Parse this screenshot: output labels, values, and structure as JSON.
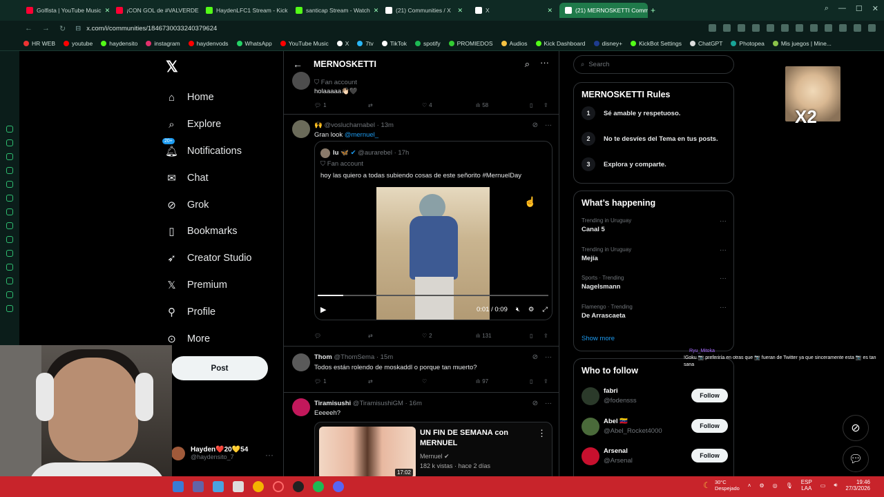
{
  "browser": {
    "tabs": [
      {
        "label": "Golfista | YouTube Music",
        "color": "#ff0033"
      },
      {
        "label": "¡CON GOL de #VALVERDE",
        "color": "#ff0033"
      },
      {
        "label": "HaydenLFC1 Stream - Kick",
        "color": "#53fc18"
      },
      {
        "label": "santicap Stream - Watch",
        "color": "#53fc18"
      },
      {
        "label": "(21) Communities / X",
        "color": "#ffffff"
      },
      {
        "label": "X",
        "color": "#ffffff"
      },
      {
        "label": "(21) MERNOSKETTI Comm",
        "color": "#ffffff"
      }
    ],
    "url": "x.com/i/communities/1846730033240379624",
    "bookmarks": [
      {
        "label": "HR WEB",
        "color": "#e33"
      },
      {
        "label": "youtube",
        "color": "#f00"
      },
      {
        "label": "haydensito",
        "color": "#53fc18"
      },
      {
        "label": "instagram",
        "color": "#e1306c"
      },
      {
        "label": "haydenvods",
        "color": "#f00"
      },
      {
        "label": "WhatsApp",
        "color": "#25d366"
      },
      {
        "label": "YouTube Music",
        "color": "#f00"
      },
      {
        "label": "X",
        "color": "#fff"
      },
      {
        "label": "7tv",
        "color": "#29b6f6"
      },
      {
        "label": "TikTok",
        "color": "#fff"
      },
      {
        "label": "spotify",
        "color": "#1db954"
      },
      {
        "label": "PROMIEDOS",
        "color": "#3c3"
      },
      {
        "label": "Audios",
        "color": "#f5c242"
      },
      {
        "label": "Kick Dashboard",
        "color": "#53fc18"
      },
      {
        "label": "disney+",
        "color": "#1e3c8f"
      },
      {
        "label": "KickBot Settings",
        "color": "#53fc18"
      },
      {
        "label": "ChatGPT",
        "color": "#ddd"
      },
      {
        "label": "Photopea",
        "color": "#18a497"
      },
      {
        "label": "Mis juegos | Mine...",
        "color": "#8bc34a"
      }
    ]
  },
  "nav": {
    "items": [
      {
        "label": "Home",
        "icon": "home-icon"
      },
      {
        "label": "Explore",
        "icon": "search-icon"
      },
      {
        "label": "Notifications",
        "icon": "bell-icon",
        "badge": "20+"
      },
      {
        "label": "Chat",
        "icon": "mail-icon"
      },
      {
        "label": "Grok",
        "icon": "grok-icon"
      },
      {
        "label": "Bookmarks",
        "icon": "bookmark-icon"
      },
      {
        "label": "Creator Studio",
        "icon": "rocket-icon"
      },
      {
        "label": "Premium",
        "icon": "x-logo-icon"
      },
      {
        "label": "Profile",
        "icon": "person-icon"
      },
      {
        "label": "More",
        "icon": "more-circle-icon"
      }
    ],
    "post_label": "Post",
    "user_name": "Hayden❤️20💛54",
    "user_handle": "@haydensito_7"
  },
  "community": {
    "title": "MERNOSKETTI"
  },
  "tweets": [
    {
      "badge": "Fan account",
      "text": "holaaaaa👋🏻🖤",
      "replies": "1",
      "likes": "4",
      "views": "58"
    },
    {
      "handle": "🙌 @voslucharnabel · 13m",
      "text": "Gran look",
      "mention": "@mernuel_",
      "quote": {
        "name": "lu 🦋",
        "handle": "@aurarebel · 17h",
        "badge": "Fan account",
        "text": "hoy las quiero a todas subiendo cosas de este señorito #MernuelDay",
        "time": "0:01 / 0:09",
        "progress": 0.11
      },
      "likes": "2",
      "views": "131"
    },
    {
      "name": "Thom",
      "handle": "@ThomSema · 15m",
      "text": "Todos están rolendo de moskaddl o porque tan muerto?",
      "replies": "1",
      "views": "97"
    },
    {
      "name": "Tiramisushi",
      "handle": "@TiramisushiGM · 16m",
      "text": "Eeeeeh?",
      "card": {
        "title": "UN FIN DE SEMANA con MERNUEL",
        "channel": "Mernuel",
        "meta": "182 k vistas · hace 2 días",
        "duration": "17:02"
      }
    }
  ],
  "search_placeholder": "Search",
  "rules": {
    "title": "MERNOSKETTI Rules",
    "items": [
      "Sé amable y respetuoso.",
      "No te desvíes del Tema en tus posts.",
      "Explora y comparte."
    ]
  },
  "happening": {
    "title": "What’s happening",
    "trends": [
      {
        "context": "Trending in Uruguay",
        "topic": "Canal 5"
      },
      {
        "context": "Trending in Uruguay",
        "topic": "Mejía"
      },
      {
        "context": "Sports · Trending",
        "topic": "Nagelsmann"
      },
      {
        "context": "Flamengo · Trending",
        "topic": "De Arrascaeta"
      }
    ],
    "show_more": "Show more"
  },
  "who_to_follow": {
    "title": "Who to follow",
    "accounts": [
      {
        "name": "fabri",
        "handle": "@fodensss"
      },
      {
        "name": "Abel 🇻🇪",
        "handle": "@Abel_Rocket4000"
      },
      {
        "name": "Arsenal",
        "handle": "@Arsenal"
      }
    ],
    "follow_label": "Follow"
  },
  "overlay": {
    "multiplier": "X2",
    "chat_user": "Ryu_Mitoka",
    "chat_text": "!Goku 📷 preferiría en otras que 📷 fueran de Twitter ya que sinceramente esta 📷 es tan sana"
  },
  "taskbar": {
    "temp": "30°C",
    "weather": "Despejado",
    "lang": "ESP",
    "region": "LAA",
    "time": "19:46",
    "date": "27/3/2026"
  }
}
